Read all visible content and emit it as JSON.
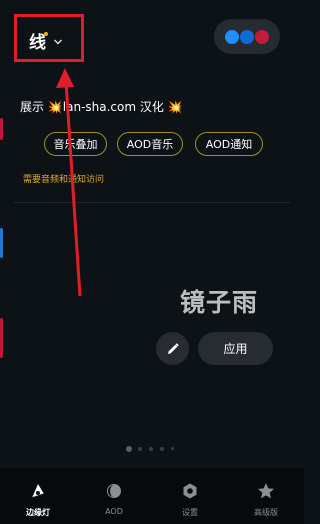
{
  "header": {
    "title": "线",
    "theme_colors": [
      "#1e90ff",
      "#0d6bd6",
      "#c51b3a"
    ]
  },
  "showcase": {
    "prefix": "展示 ",
    "sparkle_left": "💥",
    "site": "lan-sha.com 汉化",
    "sparkle_right": "💥"
  },
  "chips": [
    "音乐叠加",
    "AOD音乐",
    "AOD通知"
  ],
  "note": "需要音频和通知访问",
  "preview": {
    "text": "镜子雨"
  },
  "actions": {
    "apply_label": "应用"
  },
  "pager": {
    "count": 5,
    "active_index": 0
  },
  "nav": [
    {
      "label": "边缘灯",
      "icon": "edge-light-icon",
      "active": true
    },
    {
      "label": "AOD",
      "icon": "aod-icon",
      "active": false
    },
    {
      "label": "设置",
      "icon": "settings-icon",
      "active": false
    },
    {
      "label": "高级版",
      "icon": "star-icon",
      "active": false
    }
  ],
  "annotation": {
    "color": "#e01e2a"
  }
}
